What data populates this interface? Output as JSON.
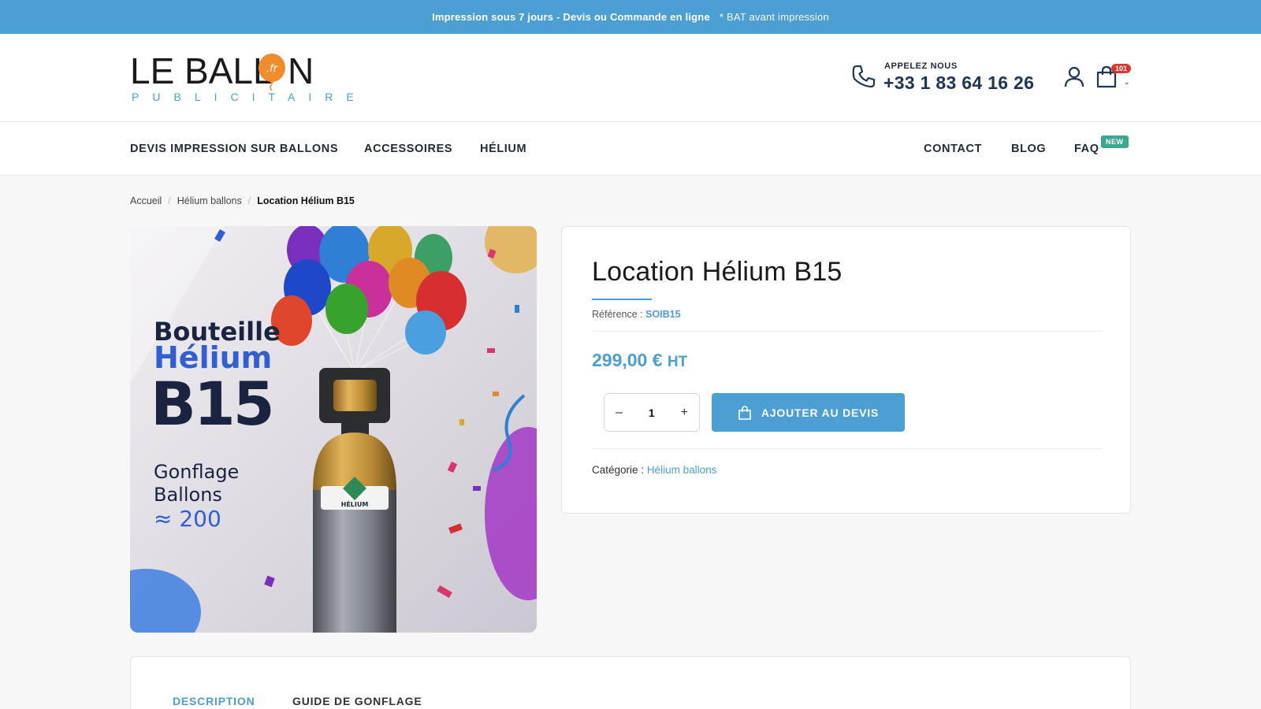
{
  "topbar": {
    "text": "Impression sous 7 jours - Devis ou Commande en ligne",
    "note": "* BAT avant impression"
  },
  "header": {
    "logo_main": "LE BALL",
    "logo_balloon_text": ".fr",
    "logo_last": "N",
    "logo_sub": "PUBLICITAIRE",
    "phone_label": "APPELEZ NOUS",
    "phone_number": "+33 1 83 64 16 26",
    "cart_count": "101",
    "colors": {
      "accent": "#4c9fd3",
      "logo_balloon": "#ef8c2c",
      "badge": "#d9362b"
    }
  },
  "nav": {
    "items_left": [
      "DEVIS IMPRESSION SUR BALLONS",
      "ACCESSOIRES",
      "HÉLIUM"
    ],
    "items_right": [
      "CONTACT",
      "BLOG",
      "FAQ"
    ],
    "faq_badge": "NEW"
  },
  "breadcrumb": [
    "Accueil",
    "Hélium ballons",
    "Location Hélium B15"
  ],
  "product_image": {
    "line1": "Bouteille",
    "line2": "Hélium",
    "line3": "B15",
    "line4": "Gonflage",
    "line5": "Ballons",
    "line6": "≈ 200",
    "label": "HÉLIUM"
  },
  "product": {
    "title": "Location Hélium B15",
    "ref_label": "Référence :",
    "ref_value": "SOIB15",
    "price": "299,00 €",
    "price_suffix": "HT",
    "quantity": "1",
    "minus": "–",
    "plus": "+",
    "add_button": "AJOUTER AU DEVIS",
    "category_label": "Catégorie :",
    "category_value": "Hélium ballons"
  },
  "tabs": [
    "DESCRIPTION",
    "GUIDE DE GONFLAGE"
  ]
}
